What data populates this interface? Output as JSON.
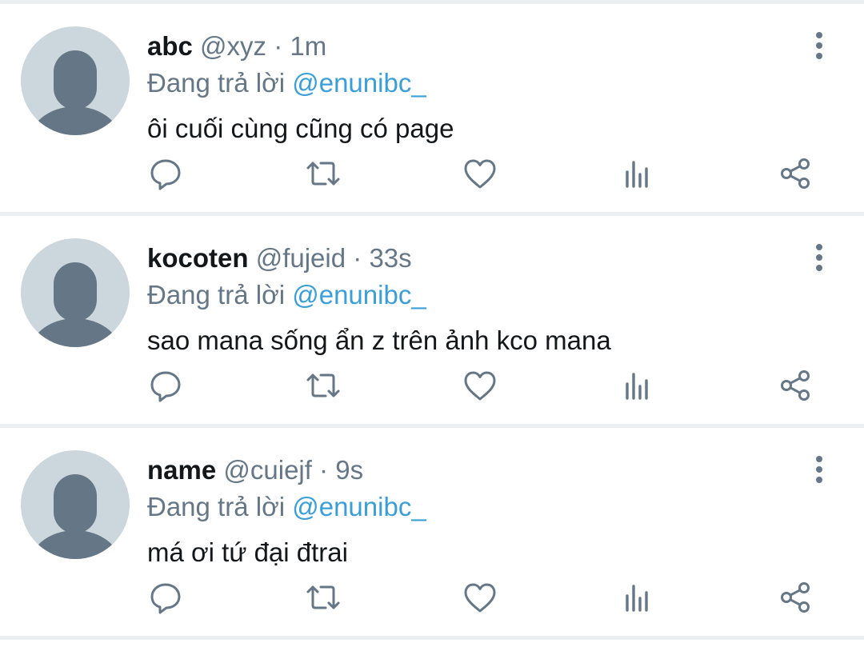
{
  "replies": [
    {
      "display_name": "abc",
      "handle": "@xyz",
      "separator": "·",
      "time": "1m",
      "reply_prefix": "Đang trả lời",
      "reply_to": "@enunibc_",
      "text": "ôi cuối cùng cũng có page"
    },
    {
      "display_name": "kocoten",
      "handle": "@fujeid",
      "separator": "·",
      "time": "33s",
      "reply_prefix": "Đang trả lời",
      "reply_to": "@enunibc_",
      "text": "sao mana sống ẩn z trên ảnh kco mana"
    },
    {
      "display_name": "name",
      "handle": "@cuiejf",
      "separator": "·",
      "time": "9s",
      "reply_prefix": "Đang trả lời",
      "reply_to": "@enunibc_",
      "text": "má ơi tứ đại đtrai"
    }
  ],
  "icons": {
    "avatar": "default-avatar-icon",
    "more": "more-vertical-icon",
    "reply": "reply-icon",
    "retweet": "retweet-icon",
    "like": "heart-icon",
    "views": "analytics-icon",
    "share": "share-icon"
  },
  "colors": {
    "text": "#14171a",
    "secondary": "#657786",
    "mention": "#3a9fd8",
    "avatar_bg": "#ccd6dd",
    "avatar_fg": "#657786",
    "divider": "#eceff1"
  }
}
